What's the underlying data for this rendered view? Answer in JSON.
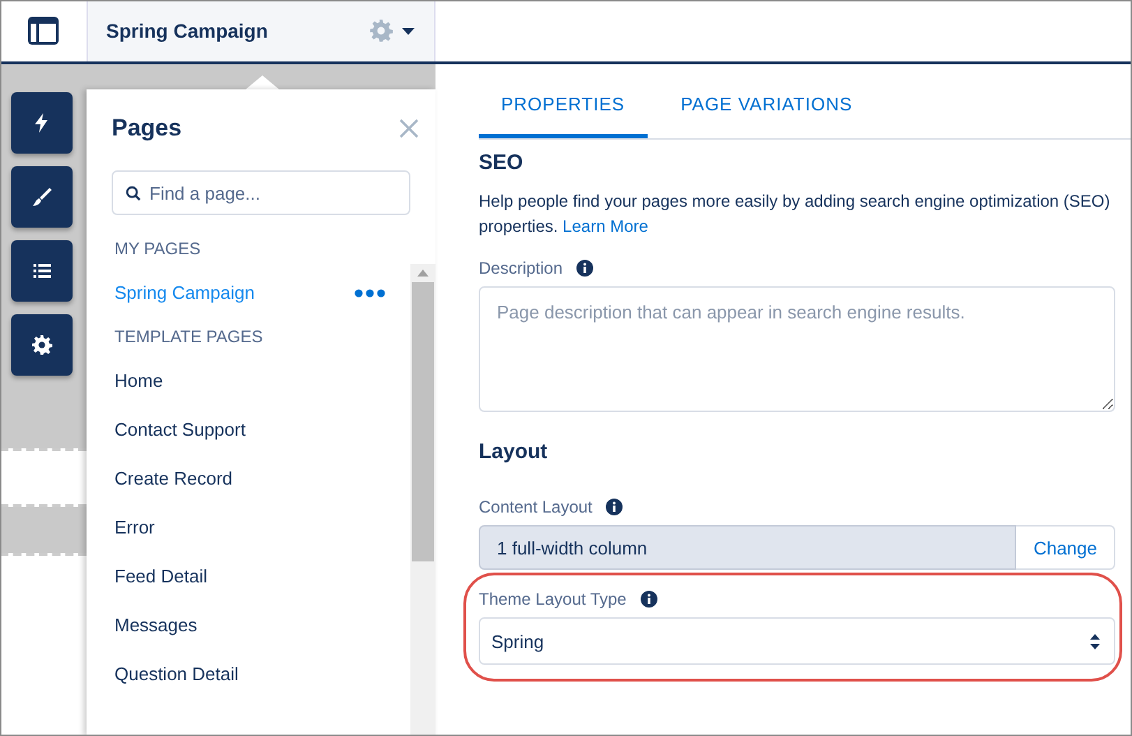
{
  "header": {
    "title": "Spring Campaign"
  },
  "rail": [
    {
      "kind": "bolt"
    },
    {
      "kind": "brush"
    },
    {
      "kind": "list"
    },
    {
      "kind": "gear"
    }
  ],
  "pages_panel": {
    "title": "Pages",
    "search": {
      "placeholder": "Find a page..."
    },
    "sections": [
      {
        "heading": "MY PAGES",
        "items": [
          {
            "label": "Spring Campaign",
            "selected": true
          }
        ]
      },
      {
        "heading": "TEMPLATE PAGES",
        "items": [
          {
            "label": "Home",
            "selected": false
          },
          {
            "label": "Contact Support",
            "selected": false
          },
          {
            "label": "Create Record",
            "selected": false
          },
          {
            "label": "Error",
            "selected": false
          },
          {
            "label": "Feed Detail",
            "selected": false
          },
          {
            "label": "Messages",
            "selected": false
          },
          {
            "label": "Question Detail",
            "selected": false
          }
        ]
      }
    ]
  },
  "tabs": [
    {
      "label": "PROPERTIES",
      "selected": true
    },
    {
      "label": "PAGE VARIATIONS",
      "selected": false
    }
  ],
  "seo": {
    "heading": "SEO",
    "help": "Help people find your pages more easily by adding search engine optimization (SEO) properties.",
    "link": "Learn More",
    "description": {
      "label": "Description",
      "placeholder": "Page description that can appear in search engine results."
    }
  },
  "layout": {
    "heading": "Layout",
    "content_layout": {
      "label": "Content Layout",
      "value": "1 full-width column",
      "button": "Change"
    },
    "theme_layout_type": {
      "label": "Theme Layout Type",
      "value": "Spring",
      "highlighted": true
    }
  }
}
